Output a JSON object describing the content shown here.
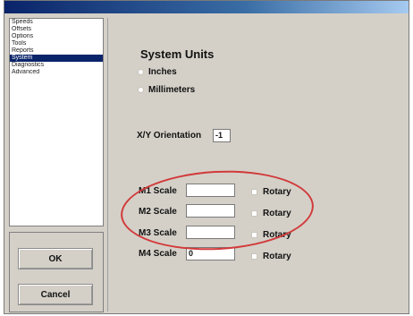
{
  "nav": {
    "items": [
      "Speeds",
      "Offsets",
      "Options",
      "Tools",
      "Reports",
      "System",
      "Diagnostics",
      "Advanced"
    ],
    "selected_index": 5
  },
  "buttons": {
    "ok": "OK",
    "cancel": "Cancel"
  },
  "system_units": {
    "title": "System Units",
    "options": [
      "Inches",
      "Millimeters"
    ]
  },
  "orientation": {
    "label": "X/Y Orientation",
    "value": "-1"
  },
  "scales": [
    {
      "label": "M1 Scale",
      "value": "",
      "rotary": "Rotary"
    },
    {
      "label": "M2 Scale",
      "value": "",
      "rotary": "Rotary"
    },
    {
      "label": "M3 Scale",
      "value": "",
      "rotary": "Rotary"
    },
    {
      "label": "M4 Scale",
      "value": "0",
      "rotary": "Rotary"
    }
  ],
  "colors": {
    "highlight_ellipse": "#d23a3a",
    "selection": "#0a246a",
    "titlebar": "#0a246a"
  }
}
